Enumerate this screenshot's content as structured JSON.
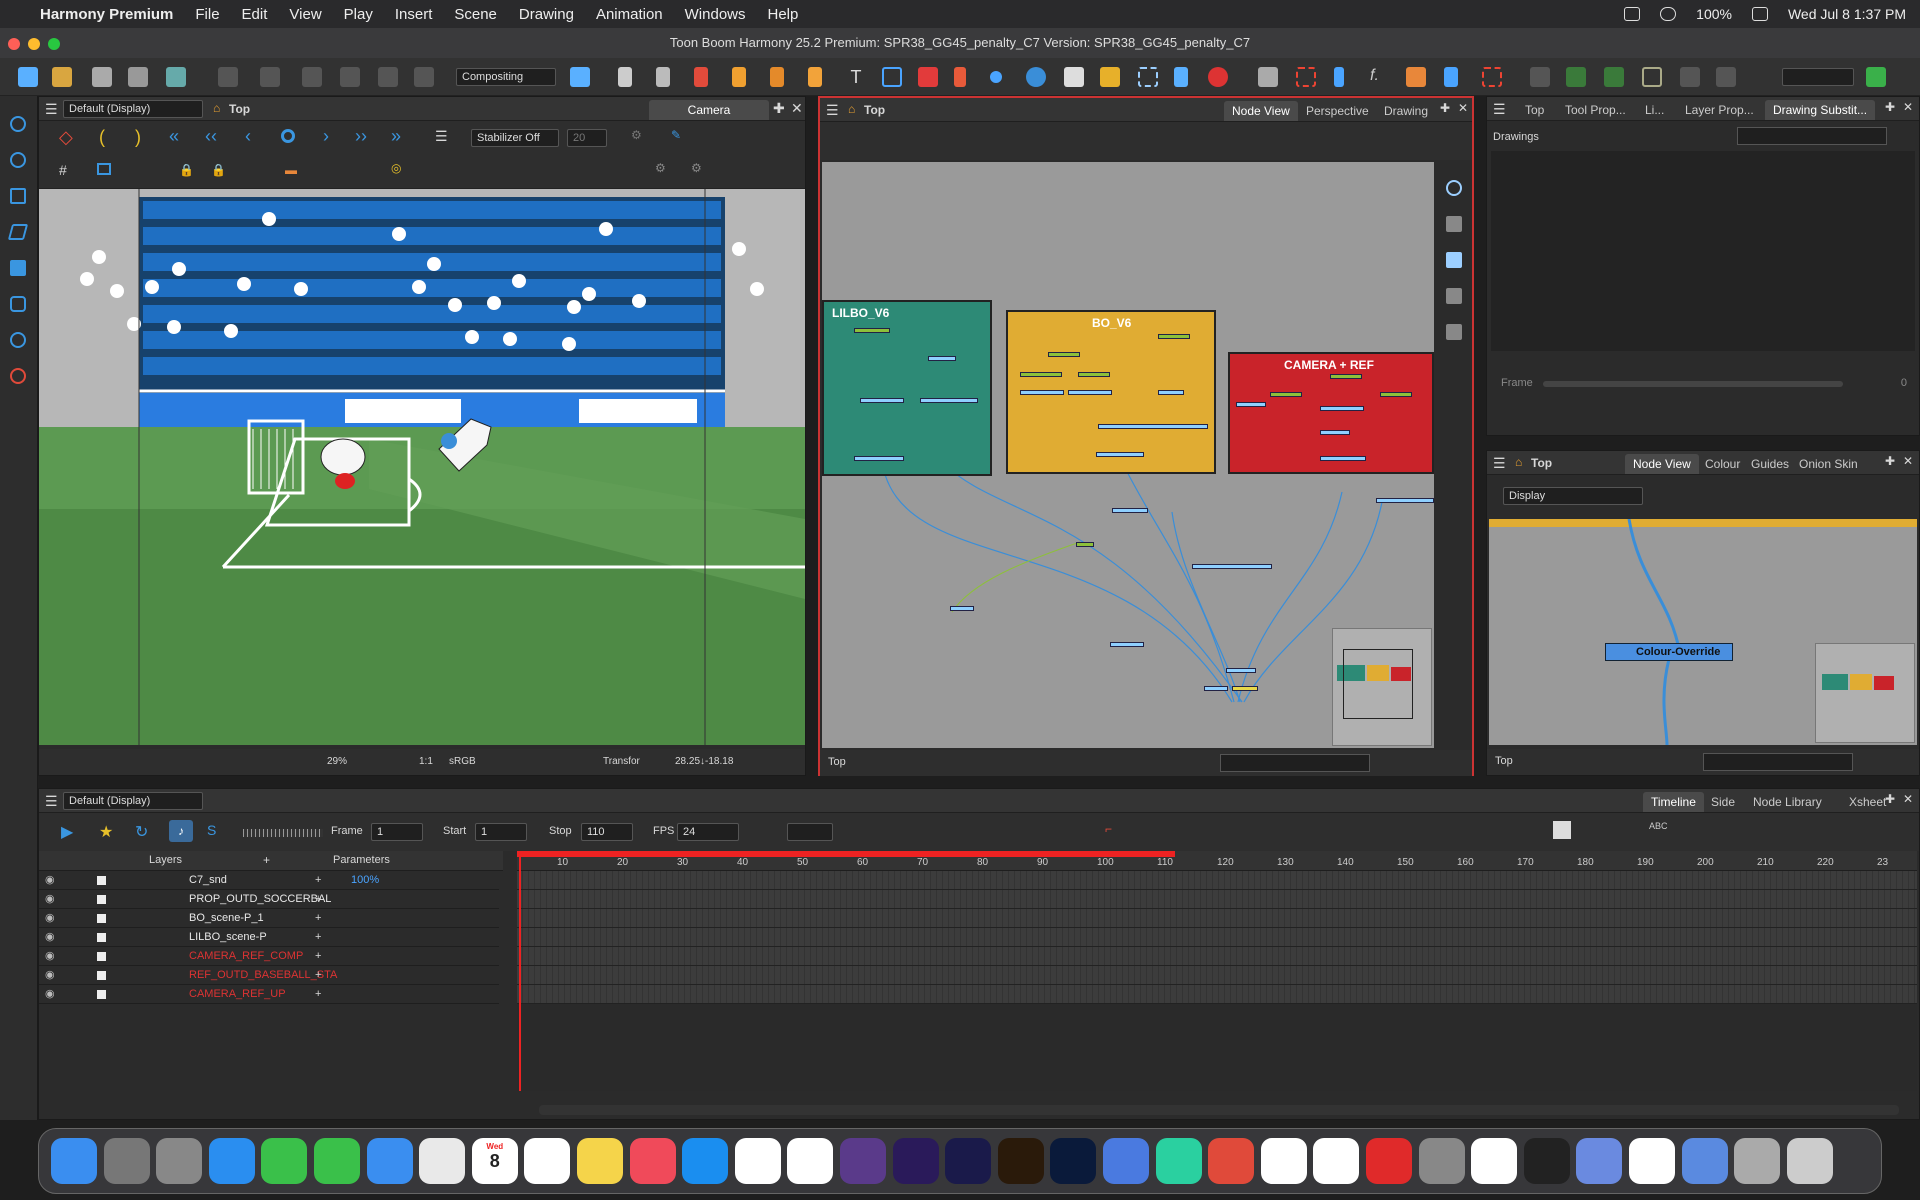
{
  "menubar": {
    "app_name": "Harmony Premium",
    "items": [
      "File",
      "Edit",
      "View",
      "Play",
      "Insert",
      "Scene",
      "Drawing",
      "Animation",
      "Windows",
      "Help"
    ],
    "battery": "100%",
    "datetime": "Wed Jul 8  1:37 PM"
  },
  "window": {
    "title": "Toon Boom Harmony 25.2 Premium: SPR38_GG45_penalty_C7 Version: SPR38_GG45_penalty_C7"
  },
  "toolbar": {
    "workspace": "Compositing"
  },
  "camera_view": {
    "display": "Default (Display)",
    "breadcrumb": "Top",
    "tab": "Camera",
    "stabilizer": "Stabilizer Off",
    "stabilizer_value": "20",
    "zoom": "29%",
    "ratio": "1:1",
    "color_space": "sRGB",
    "mode": "Transfor",
    "coords": "28.25↓-18.18"
  },
  "node_view": {
    "breadcrumb": "Top",
    "tabs": [
      "Node View",
      "Perspective",
      "Drawing"
    ],
    "groups": [
      {
        "name": "LILBO_V6",
        "color": "#2d8a76"
      },
      {
        "name": "BO_V6",
        "color": "#e0ac33"
      },
      {
        "name": "CAMERA + REF",
        "color": "#c9232a"
      }
    ],
    "footer": "Top"
  },
  "drawing_sub_panel": {
    "tabs": [
      "Top",
      "Tool Prop...",
      "Li...",
      "Layer Prop...",
      "Drawing Substit..."
    ],
    "label": "Drawings",
    "frame_label": "Frame",
    "frame_value": "0"
  },
  "node_view_2": {
    "breadcrumb": "Top",
    "tabs": [
      "Node View",
      "Colour",
      "Guides",
      "Onion Skin"
    ],
    "display": "Display",
    "node_label": "Colour-Override",
    "footer": "Top"
  },
  "timeline": {
    "display": "Default (Display)",
    "tabs": [
      "Timeline",
      "Side",
      "Node Library",
      "Xsheet"
    ],
    "frame_label": "Frame",
    "frame_value": "1",
    "start_label": "Start",
    "start_value": "1",
    "stop_label": "Stop",
    "stop_value": "110",
    "fps_label": "FPS",
    "fps_value": "24",
    "layers_header": "Layers",
    "params_header": "Parameters",
    "params_value": "100%",
    "ruler": [
      "10",
      "20",
      "30",
      "40",
      "50",
      "60",
      "70",
      "80",
      "90",
      "100",
      "110",
      "120",
      "130",
      "140",
      "150",
      "160",
      "170",
      "180",
      "190",
      "200",
      "210",
      "220",
      "23"
    ],
    "layers": [
      {
        "name": "C7_snd",
        "color": "#e8e8e8"
      },
      {
        "name": "PROP_OUTD_SOCCERBAL",
        "color": "#e8e8e8"
      },
      {
        "name": "BO_scene-P_1",
        "color": "#e8e8e8"
      },
      {
        "name": "LILBO_scene-P",
        "color": "#e8e8e8"
      },
      {
        "name": "CAMERA_REF_COMP",
        "color": "#d33"
      },
      {
        "name": "REF_OUTD_BASEBALL_STA",
        "color": "#d33"
      },
      {
        "name": "CAMERA_REF_UP",
        "color": "#d33"
      }
    ]
  },
  "dock": {
    "calendar_month": "Wed",
    "calendar_day": "8",
    "apps": [
      "Finder",
      "Launchpad",
      "Settings",
      "Safari",
      "Messages",
      "FaceTime",
      "Mail",
      "Photos",
      "Calendar",
      "Reminders",
      "Notes",
      "Music",
      "App Store",
      "Tasks",
      "Notion",
      "Scope",
      "Pr",
      "Ae",
      "Ai",
      "Ps",
      "Keynote",
      "Harmony",
      "Toons",
      "Chrome",
      "Freeform",
      "YouTube",
      "Stream",
      "Pause",
      "Toonbox",
      "Preview",
      "W",
      "Disk",
      "Screens",
      "Trash"
    ]
  }
}
